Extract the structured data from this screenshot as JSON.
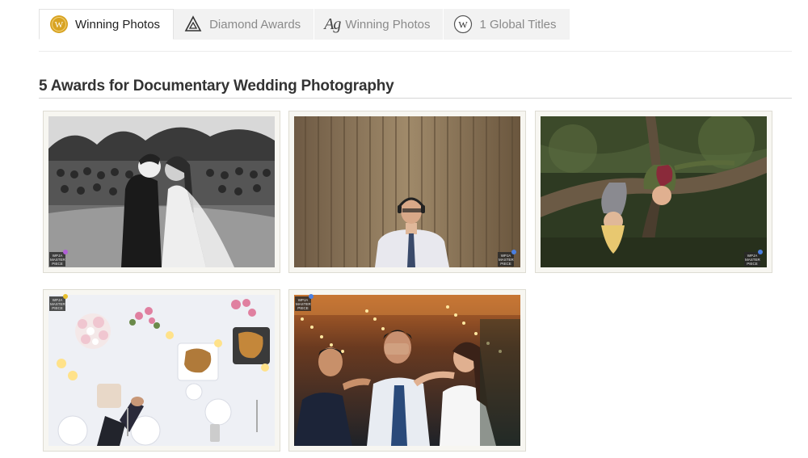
{
  "tabs": [
    {
      "label": "Winning Photos",
      "icon": "gold-medal-w-icon",
      "active": true
    },
    {
      "label": "Diamond Awards",
      "icon": "diamond-triangle-icon",
      "active": false
    },
    {
      "label": "Winning Photos",
      "icon": "ag-icon",
      "icon_text": "Ag",
      "active": false
    },
    {
      "label": "1 Global Titles",
      "icon": "w-circle-icon",
      "icon_text": "W",
      "active": false
    }
  ],
  "medal_letter": "W",
  "section": {
    "title": "5 Awards for Documentary Wedding Photography"
  },
  "badge_text": "WPJA MASTER PIECE",
  "colors": {
    "gold": "#d8a322",
    "tab_bg": "#f2f2f2",
    "frame_bg": "#f7f6f1",
    "badge_purple": "#b05fd6",
    "badge_blue": "#4a7fe0",
    "badge_yellow": "#e8c02e"
  }
}
